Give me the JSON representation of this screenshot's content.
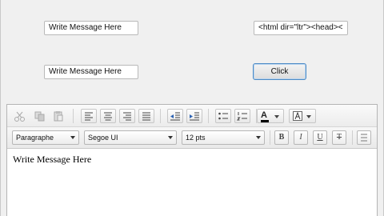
{
  "fields": {
    "message_field_1": "Write Message Here",
    "html_output_field": "<html dir=\"ltr\"><head><",
    "message_field_2": "Write Message Here"
  },
  "buttons": {
    "click_label": "Click"
  },
  "editor": {
    "toolbar_top": {
      "icons": [
        "cut-icon",
        "copy-icon",
        "paste-icon",
        "align-left-icon",
        "align-center-icon",
        "align-right-icon",
        "align-justify-icon",
        "outdent-icon",
        "indent-icon",
        "bullet-list-icon",
        "numbered-list-icon",
        "text-color-icon",
        "background-color-icon"
      ],
      "text_color_glyph": "A"
    },
    "toolbar_bottom": {
      "paragraph_format": "Paragraphe",
      "font_family": "Segoe UI",
      "font_size": "12 pts",
      "bold_glyph": "B",
      "italic_glyph": "I",
      "underline_glyph": "U",
      "strikethrough_glyph": "T"
    },
    "content": "Write Message Here"
  },
  "colors": {
    "button_border": "#4d8bc6",
    "text_color_swatch": "#000000"
  }
}
